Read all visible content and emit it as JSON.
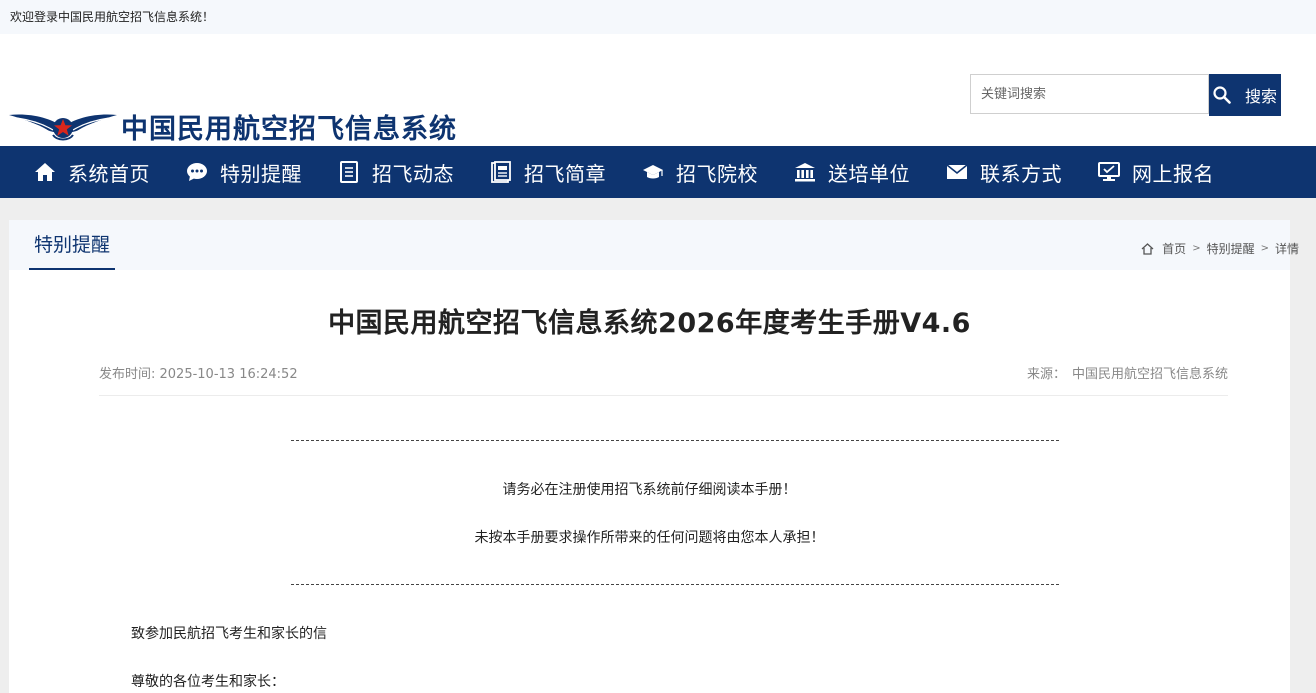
{
  "topbar": {
    "welcome": "欢迎登录中国民用航空招飞信息系统！"
  },
  "header": {
    "logo_text": "中国民用航空招飞信息系统",
    "search_placeholder": "关键词搜索",
    "search_button": "搜索"
  },
  "nav": {
    "items": [
      {
        "label": "系统首页",
        "icon": "home-icon"
      },
      {
        "label": "特别提醒",
        "icon": "chat-bubble-icon"
      },
      {
        "label": "招飞动态",
        "icon": "document-icon"
      },
      {
        "label": "招飞简章",
        "icon": "brochure-icon"
      },
      {
        "label": "招飞院校",
        "icon": "graduation-cap-icon"
      },
      {
        "label": "送培单位",
        "icon": "institution-icon"
      },
      {
        "label": "联系方式",
        "icon": "envelope-icon"
      },
      {
        "label": "网上报名",
        "icon": "monitor-icon"
      }
    ]
  },
  "panel": {
    "tab": "特别提醒",
    "breadcrumb": {
      "home": "首页",
      "sep": ">",
      "section": "特别提醒",
      "current": "详情"
    }
  },
  "article": {
    "title": "中国民用航空招飞信息系统2026年度考生手册V4.6",
    "date_label": "发布时间: ",
    "date": "2025-10-13 16:24:52",
    "source_label": "来源：",
    "source": "中国民用航空招飞信息系统",
    "notice_line1": "请务必在注册使用招飞系统前仔细阅读本手册！",
    "notice_line2": "未按本手册要求操作所带来的任何问题将由您本人承担！",
    "para1": "致参加民航招飞考生和家长的信",
    "para2": "尊敬的各位考生和家长："
  },
  "colors": {
    "brand": "#0e3470",
    "panel_head": "#f5f8fc",
    "page_bg": "#eeeeee"
  }
}
